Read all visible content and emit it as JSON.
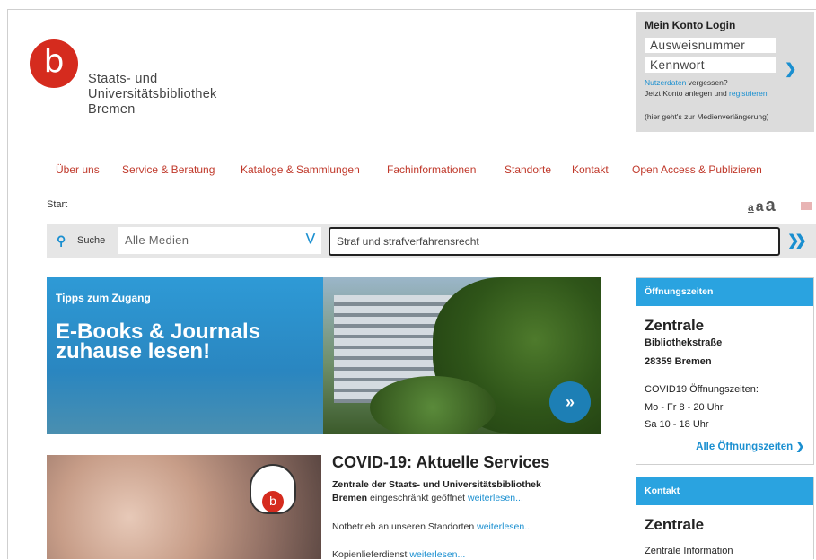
{
  "logo": {
    "letter": "b",
    "line1": "Staats- und",
    "line2": "Universitätsbibliothek",
    "line3": "Bremen"
  },
  "login": {
    "title": "Mein Konto Login",
    "id_placeholder": "Ausweisnummer",
    "pw_placeholder": "Kennwort",
    "forgot_link": "Nutzerdaten",
    "forgot_text": " vergessen?",
    "create_text": "Jetzt Konto anlegen und ",
    "register_link": "registrieren",
    "note": "(hier geht's zur Medienverlängerung)"
  },
  "nav": [
    "Über uns",
    "Service & Beratung",
    "Kataloge & Sammlungen",
    "Fachinformationen",
    "Standorte",
    "Kontakt",
    "Open Access & Publizieren"
  ],
  "breadcrumb": "Start",
  "fontsizes": [
    "a",
    "a",
    "a"
  ],
  "search": {
    "label": "Suche",
    "scope": "Alle Medien",
    "query": "Straf und strafverfahrensrecht"
  },
  "hero": {
    "tip": "Tipps zum Zugang",
    "headline1": "E-Books & Journals",
    "headline2": "zuhause lesen!"
  },
  "covid": {
    "title": "COVID-19: Aktuelle Services",
    "p1a": "Zentrale der Staats- und Universitätsbibliothek",
    "p1b": "Bremen",
    "p1c": " eingeschränkt geöffnet ",
    "p1link": "weiterlesen...",
    "p2": "Notbetrieb an unseren Standorten ",
    "p2link": "weiterlesen...",
    "p3": "Kopienlieferdienst  ",
    "p3link": "weiterlesen..."
  },
  "hours": {
    "header": "Öffnungszeiten",
    "name": "Zentrale",
    "street": "Bibliothekstraße",
    "city": "28359 Bremen",
    "line1": "COVID19 Öffnungszeiten:",
    "line2": "Mo - Fr 8 - 20 Uhr",
    "line3": "Sa 10 - 18 Uhr",
    "all_link": "Alle Öffnungszeiten"
  },
  "contact": {
    "header": "Kontakt",
    "name": "Zentrale",
    "line1": "Zentrale Information"
  },
  "colors": {
    "accent": "#1a8fd0",
    "nav": "#c0392b",
    "brand": "#d52b1e",
    "box_header": "#2aa3e0"
  }
}
